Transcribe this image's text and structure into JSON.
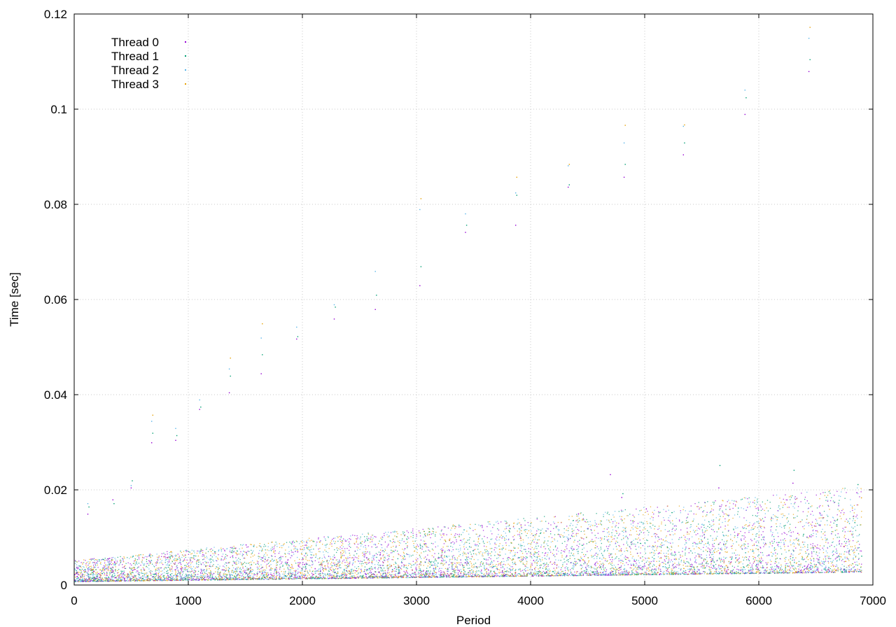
{
  "chart_data": {
    "type": "scatter",
    "title": "",
    "xlabel": "Period",
    "ylabel": "Time [sec]",
    "xlim": [
      0,
      7000
    ],
    "ylim": [
      0,
      0.12
    ],
    "xticks": [
      0,
      1000,
      2000,
      3000,
      4000,
      5000,
      6000,
      7000
    ],
    "yticks": [
      0,
      0.02,
      0.04,
      0.06,
      0.08,
      0.1,
      0.12
    ],
    "xtick_labels": [
      "0",
      "1000",
      "2000",
      "3000",
      "4000",
      "5000",
      "6000",
      "7000"
    ],
    "ytick_labels": [
      "0",
      "0.02",
      "0.04",
      "0.06",
      "0.08",
      "0.1",
      "0.12"
    ],
    "grid": true,
    "legend_position": "top-left",
    "series": [
      {
        "name": "Thread 0",
        "color": "#9400d3"
      },
      {
        "name": "Thread 1",
        "color": "#009e73"
      },
      {
        "name": "Thread 2",
        "color": "#56b4e9"
      },
      {
        "name": "Thread 3",
        "color": "#e69f00"
      }
    ],
    "bulk": {
      "x_range": [
        0,
        6900
      ],
      "baseline_start": 0.002,
      "baseline_end": 0.004,
      "spread_start": 0.003,
      "spread_end": 0.012
    },
    "outlier_clusters": [
      {
        "x": 120,
        "y": [
          0.015,
          0.0165,
          0.0172
        ]
      },
      {
        "x": 340,
        "y": [
          0.018,
          0.0172
        ]
      },
      {
        "x": 500,
        "y": [
          0.0205,
          0.022,
          0.021
        ]
      },
      {
        "x": 680,
        "y": [
          0.03,
          0.032,
          0.0345,
          0.0358
        ]
      },
      {
        "x": 890,
        "y": [
          0.0305,
          0.0315,
          0.033
        ]
      },
      {
        "x": 1100,
        "y": [
          0.037,
          0.0375,
          0.039
        ]
      },
      {
        "x": 1360,
        "y": [
          0.0405,
          0.044,
          0.0455,
          0.0478
        ]
      },
      {
        "x": 1640,
        "y": [
          0.0445,
          0.0485,
          0.052,
          0.055
        ]
      },
      {
        "x": 1950,
        "y": [
          0.0518,
          0.0523,
          0.0543
        ]
      },
      {
        "x": 2280,
        "y": [
          0.056,
          0.0585,
          0.059
        ]
      },
      {
        "x": 2640,
        "y": [
          0.058,
          0.061,
          0.066
        ]
      },
      {
        "x": 3030,
        "y": [
          0.063,
          0.067,
          0.079,
          0.0813
        ]
      },
      {
        "x": 3430,
        "y": [
          0.0742,
          0.0757,
          0.0781
        ]
      },
      {
        "x": 3870,
        "y": [
          0.0757,
          0.082,
          0.0825,
          0.0858
        ]
      },
      {
        "x": 4330,
        "y": [
          0.0837,
          0.0842,
          0.0882,
          0.0885
        ]
      },
      {
        "x": 4820,
        "y": [
          0.0858,
          0.0885,
          0.093,
          0.0967
        ]
      },
      {
        "x": 5340,
        "y": [
          0.0905,
          0.093,
          0.0965,
          0.0968
        ]
      },
      {
        "x": 5880,
        "y": [
          0.099,
          0.1025,
          0.1041
        ]
      },
      {
        "x": 6440,
        "y": [
          0.108,
          0.1105,
          0.115,
          0.1173
        ]
      },
      {
        "x": 5650,
        "y": [
          0.0205,
          0.0252
        ]
      },
      {
        "x": 6300,
        "y": [
          0.0215,
          0.0242
        ]
      },
      {
        "x": 4800,
        "y": [
          0.0185,
          0.0193
        ]
      },
      {
        "x": 4700,
        "y": [
          0.0233
        ]
      },
      {
        "x": 6860,
        "y": [
          0.0195,
          0.0212
        ]
      }
    ]
  }
}
